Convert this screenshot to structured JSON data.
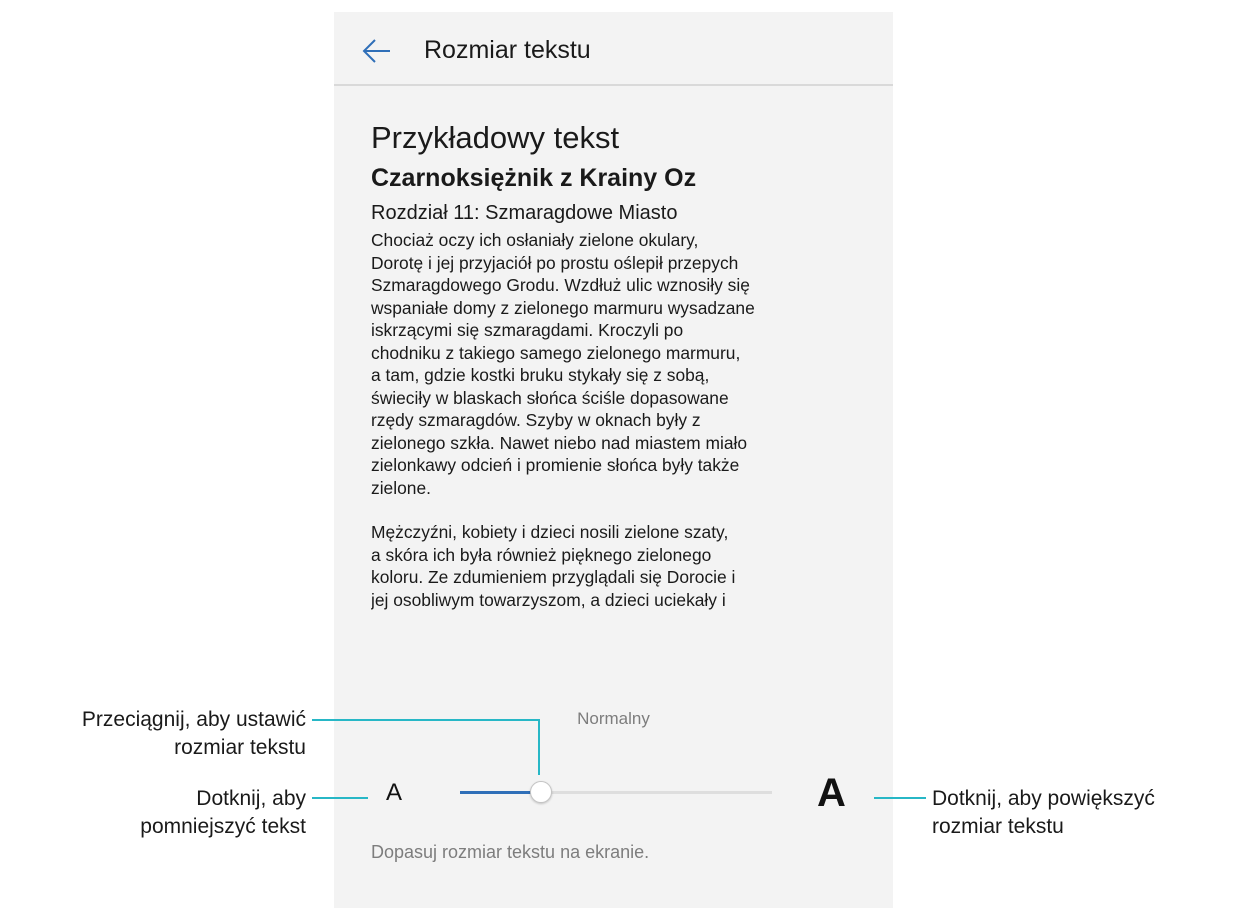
{
  "appbar": {
    "back_icon": "arrow-left-icon",
    "title": "Rozmiar tekstu",
    "accent_color": "#2f6fb8"
  },
  "preview": {
    "sample_heading": "Przykładowy tekst",
    "book_title": "Czarnoksiężnik z Krainy Oz",
    "chapter": "Rozdział 11: Szmaragdowe Miasto",
    "paragraph_1": "Chociaż oczy ich osłaniały zielone okulary,\nDorotę i jej przyjaciół po prostu oślepił przepych\nSzmaragdowego Grodu. Wzdłuż ulic wznosiły się\nwspaniałe domy z zielonego marmuru wysadzane\niskrzącymi się szmaragdami. Kroczyli po\nchodniku z takiego samego zielonego marmuru,\na tam, gdzie kostki bruku stykały się z sobą,\nświeciły w blaskach słońca ściśle dopasowane\nrzędy szmaragdów. Szyby w oknach były z\nzielonego szkła. Nawet niebo nad miastem miało\nzielonkawy odcień i promienie słońca były także\nzielone.",
    "paragraph_2": "Mężczyźni, kobiety i dzieci nosili zielone szaty,\na skóra ich była również pięknego zielonego\nkoloru. Ze zdumieniem przyglądali się Dorocie i\njej osobliwym towarzyszom, a dzieci uciekały i"
  },
  "slider": {
    "current_label": "Normalny",
    "small_label": "A",
    "large_label": "A",
    "value_percent": 26,
    "fill_color": "#2f6fb8"
  },
  "footer": {
    "note": "Dopasuj rozmiar tekstu na ekranie."
  },
  "annotations": {
    "line_color": "#27b7c6",
    "drag_line1": "Przeciągnij, aby ustawić",
    "drag_line2": "rozmiar tekstu",
    "shrink_line1": "Dotknij, aby",
    "shrink_line2": "pomniejszyć tekst",
    "enlarge_line1": "Dotknij, aby powiększyć",
    "enlarge_line2": "rozmiar tekstu"
  }
}
